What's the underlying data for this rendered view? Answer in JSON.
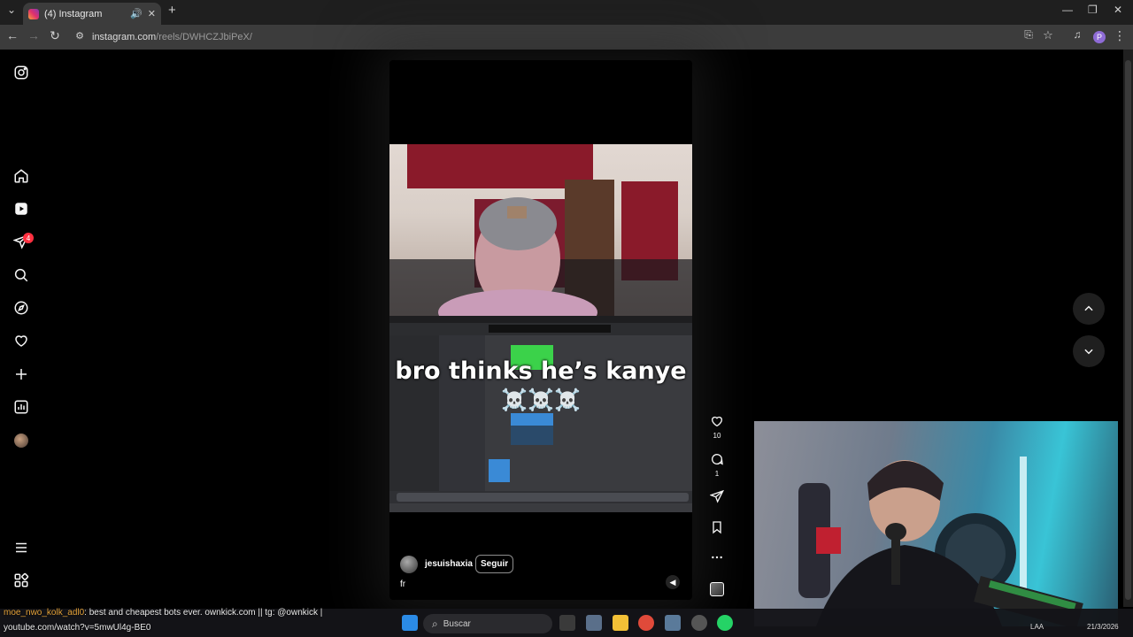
{
  "browser": {
    "tab_title": "(4) Instagram",
    "url_host": "instagram.com",
    "url_path": "/reels/DWHCZJbiPeX/",
    "profile_initial": "P"
  },
  "sidebar": {
    "notifications_badge": "4"
  },
  "reel": {
    "overlay_text": "bro thinks he’s kanye",
    "skulls": "☠️☠️☠️",
    "author": "jesuishaxia",
    "follow_label": "Seguir",
    "caption": "fr"
  },
  "actions": {
    "likes": "10",
    "comments": "1"
  },
  "taskbar": {
    "search_placeholder": "Buscar",
    "ticker_user": "moe_nwo_kolk_adl0",
    "ticker_text": ": best and cheapest bots ever. ownkick.com || tg: @ownkick |",
    "ticker_url": "youtube.com/watch?v=5mwUl4g-BE0",
    "lang": "LAA",
    "date": "21/3/2026"
  },
  "colors": {
    "brand_gradient": [
      "#f9a43a",
      "#e1306c",
      "#833ab4"
    ],
    "badge": "#ff3040",
    "background": "#000000"
  }
}
